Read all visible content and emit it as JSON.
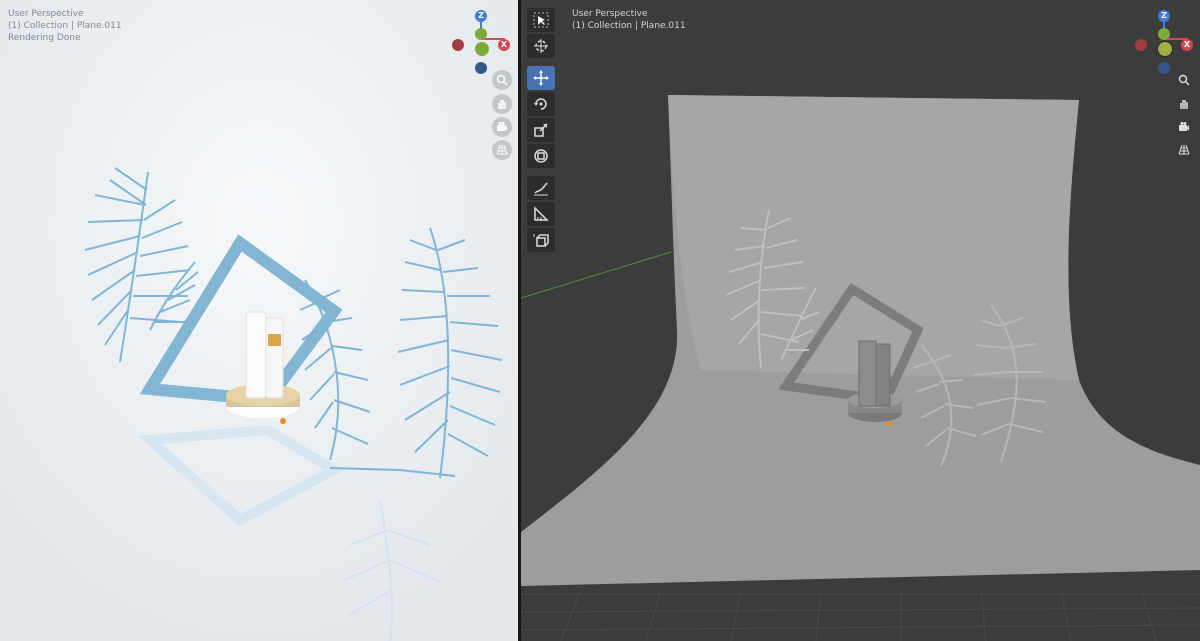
{
  "left_viewport": {
    "overlay_lines": [
      "User Perspective",
      "(1) Collection | Plane.011",
      "Rendering Done"
    ],
    "background_color": "#ecf0f3",
    "accent_color": "#7fb5d4"
  },
  "right_viewport": {
    "overlay_lines": [
      "User Perspective",
      "(1) Collection | Plane.011"
    ],
    "background_color": "#3c3c3c",
    "model_color": "#9d9d9d"
  },
  "gizmo": {
    "z_label": "Z",
    "x_label": "X",
    "x_color": "#d24a55",
    "y_color": "#7cab3a",
    "z_color": "#3f7ed6"
  },
  "nav_buttons": [
    "zoom-icon",
    "hand-icon",
    "camera-icon",
    "grid-icon"
  ],
  "toolbar": {
    "tools": [
      "select-box-icon",
      "cursor-icon",
      "move-icon",
      "rotate-icon",
      "scale-icon",
      "transform-icon",
      "annotate-icon",
      "measure-icon",
      "add-cube-icon"
    ],
    "active_tool": "move-icon"
  }
}
